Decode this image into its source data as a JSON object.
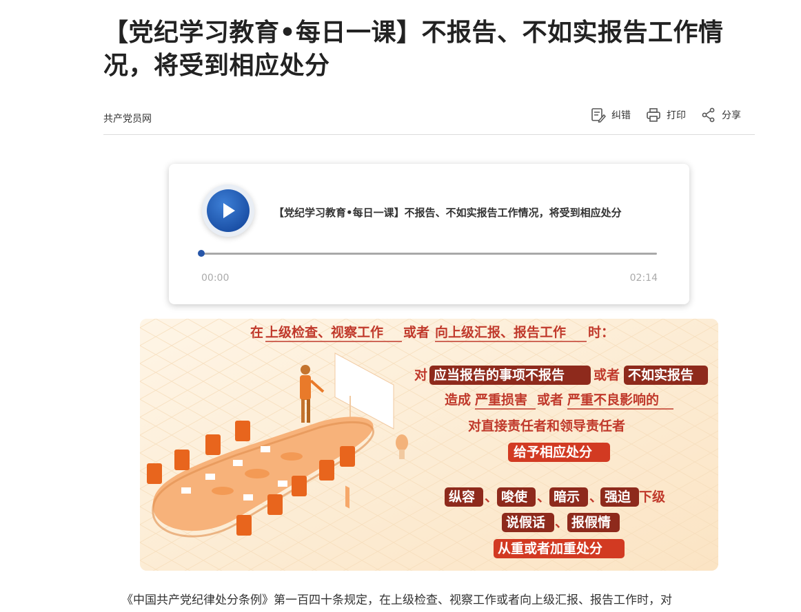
{
  "article": {
    "title": "【党纪学习教育•每日一课】不报告、不如实报告工作情况，将受到相应处分",
    "source": "共产党员网",
    "body_start": "《中国共产党纪律处分条例》第一百四十条规定，在上级检查、视察工作或者向上级汇报、报告工作时，对"
  },
  "toolbar": {
    "correct_label": "纠错",
    "print_label": "打印",
    "share_label": "分享"
  },
  "audio": {
    "title": "【党纪学习教育•每日一课】不报告、不如实报告工作情况，将受到相应处分",
    "current_time": "00:00",
    "total_time": "02:14",
    "progress": 0
  },
  "infographic": {
    "header": {
      "prefix": "在",
      "part1": "上级检查、视察工作",
      "mid": "或者",
      "part2": "向上级汇报、报告工作",
      "suffix": "时："
    },
    "line1": {
      "prefix": "对",
      "tag1": "应当报告的事项不报告",
      "mid": "或者",
      "tag2": "不如实报告"
    },
    "line2": {
      "prefix": "造成",
      "part1": "严重损害",
      "mid": "或者",
      "part2": "严重不良影响的"
    },
    "line3": "对直接责任者和领导责任者",
    "line4": "给予相应处分",
    "line5": {
      "tag1": "纵容",
      "sep1": "、",
      "tag2": "唆使",
      "sep2": "、",
      "tag3": "暗示",
      "sep3": "、",
      "tag4": "强迫",
      "suffix": "下级"
    },
    "line6": {
      "tag1": "说假话",
      "sep": "、",
      "tag2": "报假情"
    },
    "line7": "从重或者加重处分"
  },
  "colors": {
    "accent_red": "#c0392b",
    "tag_dark_red": "#8e2a1c",
    "orange": "#f08a3c",
    "player_blue": "#2756a8",
    "bg_cream": "#fdf0dc"
  }
}
